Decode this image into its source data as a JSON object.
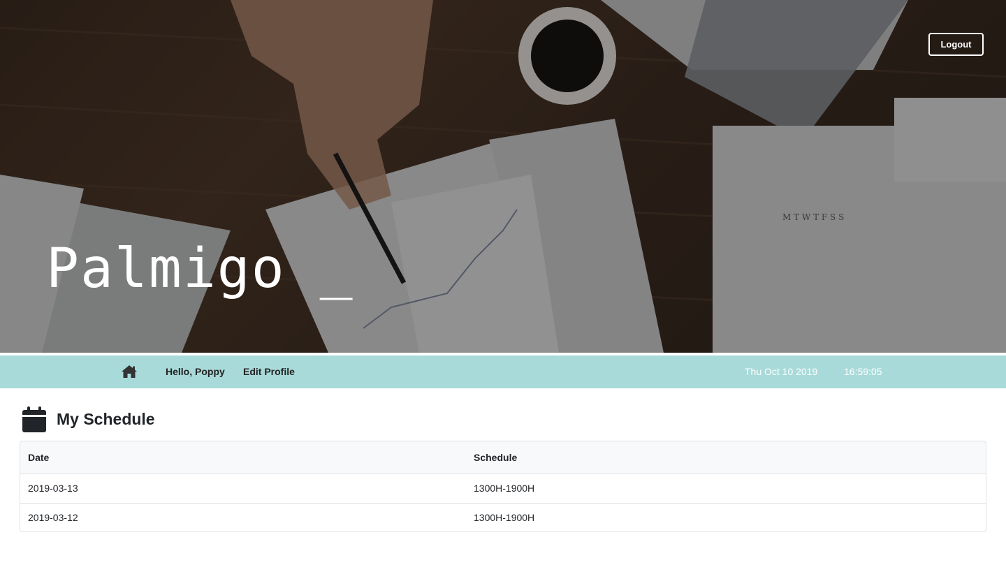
{
  "header": {
    "logout_label": "Logout",
    "brand": "Palmigo _"
  },
  "nav": {
    "home_icon": "home-icon",
    "hello": "Hello, Poppy",
    "edit_profile": "Edit Profile",
    "date": "Thu Oct 10 2019",
    "time": "16:59:05",
    "bar_color": "#a8dad9"
  },
  "schedule": {
    "icon": "calendar-icon",
    "title": "My Schedule",
    "columns": [
      "Date",
      "Schedule"
    ],
    "rows": [
      {
        "date": "2019-03-13",
        "schedule": "1300H-1900H"
      },
      {
        "date": "2019-03-12",
        "schedule": "1300H-1900H"
      }
    ]
  }
}
